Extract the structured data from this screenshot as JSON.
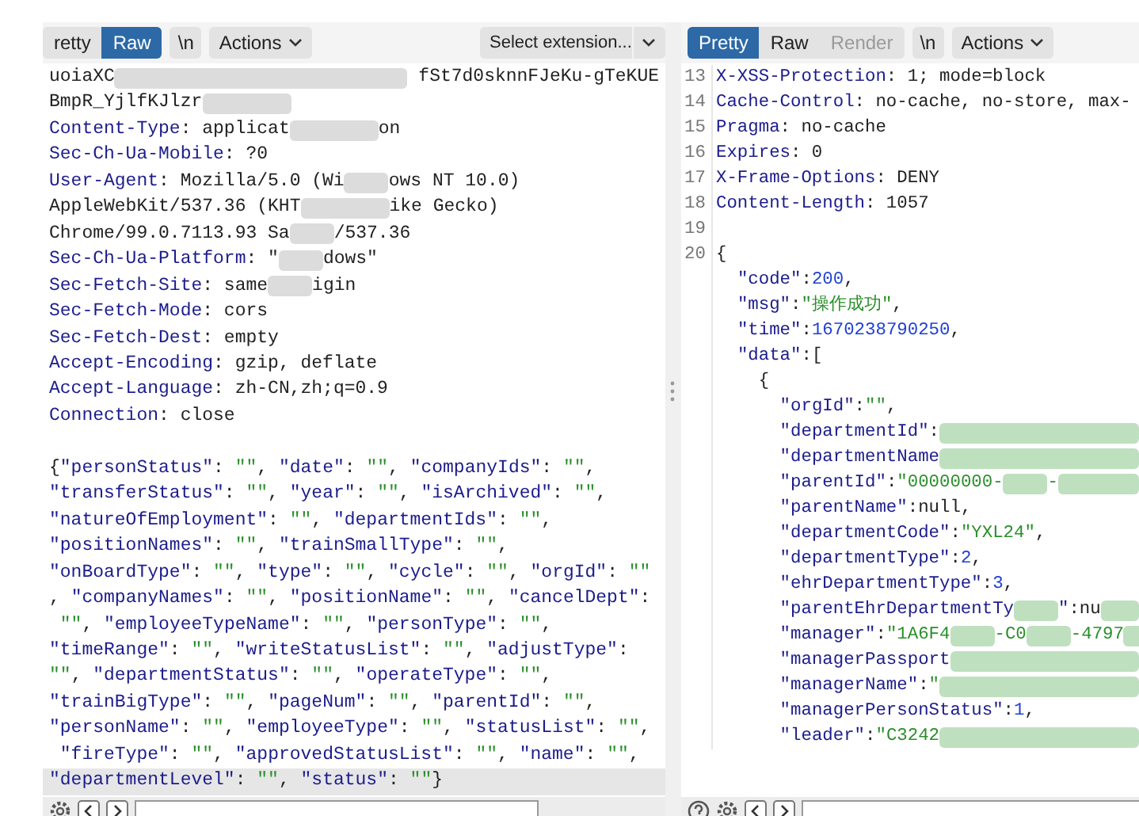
{
  "request": {
    "tabs": [
      {
        "label": "retty",
        "selected": false,
        "disabled": false
      },
      {
        "label": "Raw",
        "selected": true,
        "disabled": false
      }
    ],
    "newline_button": "\\n",
    "actions_button": "Actions",
    "extension_select": "Select extension...",
    "lines": [
      {
        "kind": "plain",
        "parts": [
          "uoiaXC",
          {
            "kind": "blur-fill"
          },
          " fSt7d0sknnFJeKu-gTeKUE"
        ]
      },
      {
        "kind": "plain",
        "parts": [
          "BmpR_YjlfKJlzr",
          {
            "kind": "blur-medium"
          }
        ]
      },
      {
        "kind": "header",
        "parts": [
          "Content-Type: applicat",
          {
            "kind": "blur-medium"
          },
          "on"
        ]
      },
      {
        "kind": "header",
        "parts": [
          "Sec-Ch-Ua-Mobile: ?0"
        ]
      },
      {
        "kind": "header",
        "parts": [
          "User-Agent: Mozilla/5.0 (Wi",
          {
            "kind": "blur-short"
          },
          "ows NT 10.0)"
        ]
      },
      {
        "kind": "plain",
        "parts": [
          "AppleWebKit/537.36 (KHT",
          {
            "kind": "blur-medium"
          },
          "ike Gecko)"
        ]
      },
      {
        "kind": "plain",
        "parts": [
          "Chrome/99.0.7113.93 Sa",
          {
            "kind": "blur-short"
          },
          "/537.36"
        ]
      },
      {
        "kind": "header",
        "parts": [
          "Sec-Ch-Ua-Platform: \"",
          {
            "kind": "blur-short"
          },
          "dows\""
        ]
      },
      {
        "kind": "header",
        "parts": [
          "Sec-Fetch-Site: same",
          {
            "kind": "blur-short"
          },
          "igin"
        ]
      },
      {
        "kind": "header",
        "parts": [
          "Sec-Fetch-Mode: cors"
        ]
      },
      {
        "kind": "header",
        "parts": [
          "Sec-Fetch-Dest: empty"
        ]
      },
      {
        "kind": "header",
        "parts": [
          "Accept-Encoding: gzip, deflate"
        ]
      },
      {
        "kind": "header",
        "parts": [
          "Accept-Language: zh-CN,zh;q=0.9"
        ]
      },
      {
        "kind": "header",
        "parts": [
          "Connection: close"
        ]
      }
    ],
    "body_lines": [
      {
        "text": "{\"personStatus\": \"\", \"date\": \"\", \"companyIds\": \"\",",
        "highlighted": false
      },
      {
        "text": "\"transferStatus\": \"\", \"year\": \"\", \"isArchived\": \"\",",
        "highlighted": false
      },
      {
        "text": "\"natureOfEmployment\": \"\", \"departmentIds\": \"\",",
        "highlighted": false
      },
      {
        "text": "\"positionNames\": \"\", \"trainSmallType\": \"\",",
        "highlighted": false
      },
      {
        "text": "\"onBoardType\": \"\", \"type\": \"\", \"cycle\": \"\", \"orgId\": \"\"",
        "highlighted": false
      },
      {
        "text": ", \"companyNames\": \"\", \"positionName\": \"\", \"cancelDept\":",
        "highlighted": false
      },
      {
        "text": " \"\", \"employeeTypeName\": \"\", \"personType\": \"\",",
        "highlighted": false
      },
      {
        "text": "\"timeRange\": \"\", \"writeStatusList\": \"\", \"adjustType\":",
        "highlighted": false
      },
      {
        "text": "\"\", \"departmentStatus\": \"\", \"operateType\": \"\",",
        "highlighted": false
      },
      {
        "text": "\"trainBigType\": \"\", \"pageNum\": \"\", \"parentId\": \"\",",
        "highlighted": false
      },
      {
        "text": "\"personName\": \"\", \"employeeType\": \"\", \"statusList\": \"\",",
        "highlighted": false
      },
      {
        "text": " \"fireType\": \"\", \"approvedStatusList\": \"\", \"name\": \"\",",
        "highlighted": false
      },
      {
        "text": "\"departmentLevel\": \"\", \"status\": \"\"}",
        "highlighted": true
      }
    ]
  },
  "response": {
    "tabs": [
      {
        "label": "Pretty",
        "selected": true,
        "disabled": false
      },
      {
        "label": "Raw",
        "selected": false,
        "disabled": false
      },
      {
        "label": "Render",
        "selected": false,
        "disabled": true
      }
    ],
    "newline_button": "\\n",
    "actions_button": "Actions",
    "lines": [
      {
        "number": "13",
        "kind": "header",
        "parts": [
          "X-XSS-Protection: 1; mode=block"
        ]
      },
      {
        "number": "14",
        "kind": "header",
        "parts": [
          "Cache-Control: no-cache, no-store, max-"
        ]
      },
      {
        "number": "15",
        "kind": "header",
        "parts": [
          "Pragma: no-cache"
        ]
      },
      {
        "number": "16",
        "kind": "header",
        "parts": [
          "Expires: 0"
        ]
      },
      {
        "number": "17",
        "kind": "header",
        "parts": [
          "X-Frame-Options: DENY"
        ]
      },
      {
        "number": "18",
        "kind": "header",
        "parts": [
          "Content-Length: 1057"
        ]
      },
      {
        "number": "19",
        "kind": "json"
      },
      {
        "number": "20",
        "kind": "json",
        "parts": [
          "{"
        ]
      },
      {
        "kind": "json",
        "parts": [
          "  \"code\":200,"
        ]
      },
      {
        "kind": "json",
        "parts": [
          "  \"msg\":\"操作成功\","
        ]
      },
      {
        "kind": "json",
        "parts": [
          "  \"time\":1670238790250,"
        ]
      },
      {
        "kind": "json",
        "parts": [
          "  \"data\":["
        ]
      },
      {
        "kind": "json",
        "parts": [
          "    {"
        ]
      },
      {
        "kind": "json",
        "parts": [
          "      \"orgId\":\"\","
        ]
      },
      {
        "kind": "json",
        "parts": [
          "      \"departmentId\":",
          {
            "kind": "blur-fill"
          }
        ]
      },
      {
        "kind": "json",
        "parts": [
          "      \"departmentName",
          {
            "kind": "blur-fill"
          }
        ]
      },
      {
        "kind": "json",
        "parts": [
          "      \"parentId\":\"00000000-",
          {
            "kind": "blur-short"
          },
          "-",
          {
            "kind": "blur-fill"
          }
        ]
      },
      {
        "kind": "json",
        "parts": [
          "      \"parentName\":null,"
        ]
      },
      {
        "kind": "json",
        "parts": [
          "      \"departmentCode\":\"YXL24\","
        ]
      },
      {
        "kind": "json",
        "parts": [
          "      \"departmentType\":2,"
        ]
      },
      {
        "kind": "json",
        "parts": [
          "      \"ehrDepartmentType\":3,"
        ]
      },
      {
        "kind": "json",
        "parts": [
          "      \"parentEhrDepartmentTy",
          {
            "kind": "blur-short"
          },
          "\":nu",
          {
            "kind": "blur-fill"
          }
        ]
      },
      {
        "kind": "json",
        "parts": [
          "      \"manager\":\"1A6F4",
          {
            "kind": "blur-short"
          },
          "-C0",
          {
            "kind": "blur-short"
          },
          "-4797",
          {
            "kind": "blur-fill"
          }
        ]
      },
      {
        "kind": "json",
        "parts": [
          "      \"managerPassport",
          {
            "kind": "blur-fill"
          }
        ]
      },
      {
        "kind": "json",
        "parts": [
          "      \"managerName\":\"",
          {
            "kind": "blur-fill"
          }
        ]
      },
      {
        "kind": "json",
        "parts": [
          "      \"managerPersonStatus\":1,"
        ]
      },
      {
        "kind": "json",
        "parts": [
          "      \"leader\":\"C3242",
          {
            "kind": "blur-fill"
          }
        ]
      }
    ]
  }
}
